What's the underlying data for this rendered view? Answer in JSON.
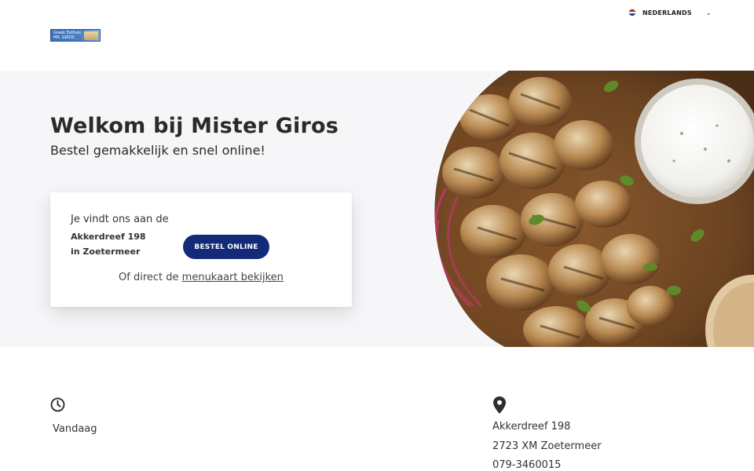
{
  "header": {
    "logo": {
      "line1": "Greek Eethuis",
      "line2": "MR. GIROS"
    },
    "language": {
      "label": "NEDERLANDS",
      "flag_colors": [
        "#ae1c28",
        "#ffffff",
        "#21468b"
      ]
    }
  },
  "hero": {
    "title": "Welkom bij Mister Giros",
    "subtitle": "Bestel gemakkelijk en snel online!",
    "card": {
      "find_text": "Je vindt ons aan de",
      "street": "Akkerdreef 198",
      "city": "in Zoetermeer",
      "order_button": "BESTEL ONLINE",
      "menu_prefix": "Of direct de ",
      "menu_link": "menukaart bekijken"
    }
  },
  "info": {
    "hours": {
      "icon": "clock-icon",
      "day": "Vandaag"
    },
    "address": {
      "icon": "location-pin-icon",
      "street": "Akkerdreef 198",
      "postal_city": "2723 XM Zoetermeer",
      "phone": "079-3460015"
    }
  },
  "colors": {
    "accent": "#132a78",
    "hero_bg": "#f6f6f8"
  }
}
